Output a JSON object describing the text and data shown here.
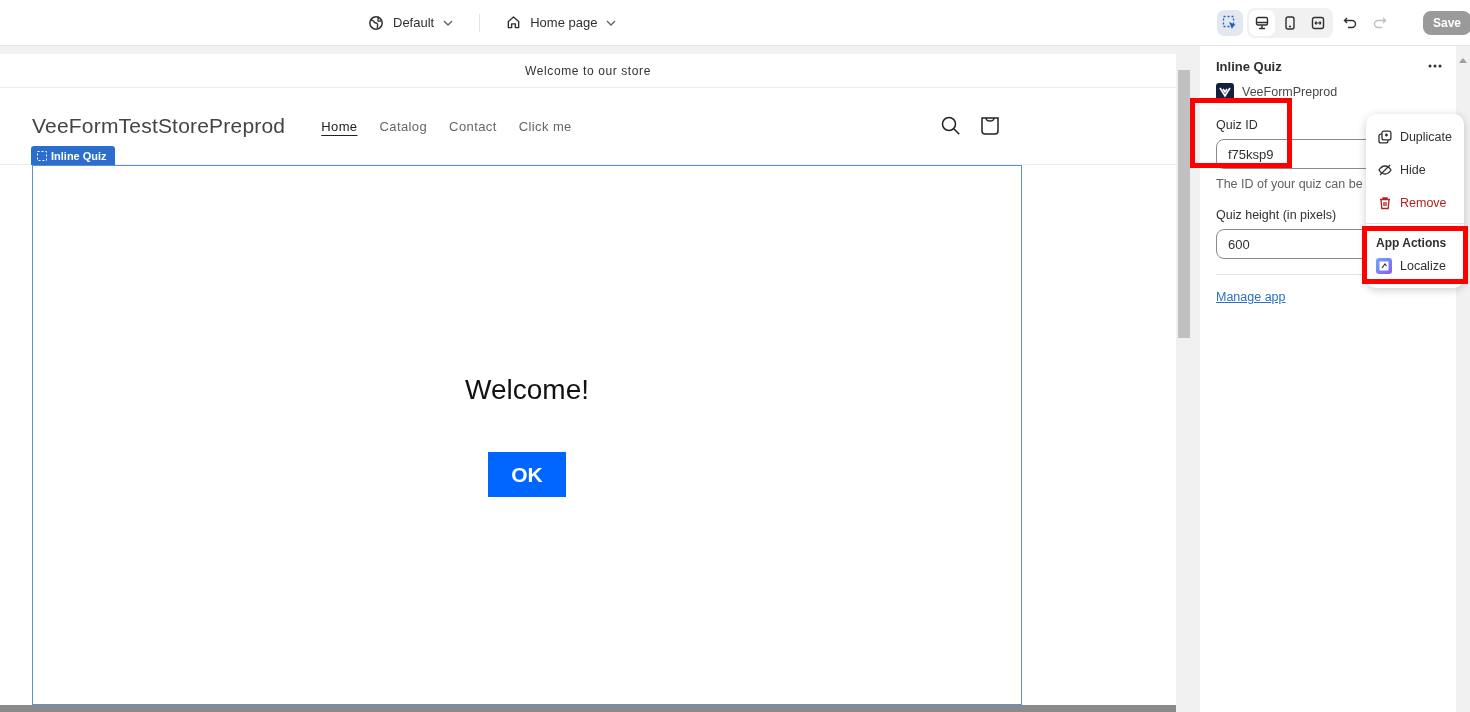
{
  "topbar": {
    "theme": "Default",
    "template": "Home page",
    "select_tool": {
      "selected": true
    },
    "devices": [
      {
        "kind": "desktop",
        "selected": true
      },
      {
        "kind": "mobile",
        "selected": false
      },
      {
        "kind": "fullwidth",
        "selected": false
      }
    ],
    "undo": {
      "disabled": false
    },
    "redo": {
      "disabled": true
    },
    "save": {
      "label": "Save",
      "disabled": true
    }
  },
  "preview": {
    "announcement": "Welcome to our store",
    "store_name": "VeeFormTestStorePreprod",
    "nav": [
      {
        "label": "Home",
        "selected": true
      },
      {
        "label": "Catalog",
        "selected": false
      },
      {
        "label": "Contact",
        "selected": false
      },
      {
        "label": "Click me",
        "selected": false
      }
    ],
    "section_tag": "Inline Quiz",
    "quiz": {
      "heading": "Welcome!",
      "button": "OK"
    }
  },
  "panel": {
    "title": "Inline Quiz",
    "app_name": "VeeFormPreprod",
    "fields": [
      {
        "label": "Quiz ID",
        "value": "f75ksp9",
        "help": "The ID of your quiz can be",
        "highlighted": true
      },
      {
        "label": "Quiz height (in pixels)",
        "value": "600",
        "highlighted": false
      }
    ],
    "link": "Manage app"
  },
  "menu": {
    "items": [
      {
        "kind": "duplicate",
        "label": "Duplicate"
      },
      {
        "kind": "hide",
        "label": "Hide"
      },
      {
        "kind": "remove",
        "label": "Remove"
      }
    ],
    "section": {
      "title": "App Actions",
      "highlighted": true,
      "items": [
        {
          "label": "Localize"
        }
      ]
    }
  }
}
